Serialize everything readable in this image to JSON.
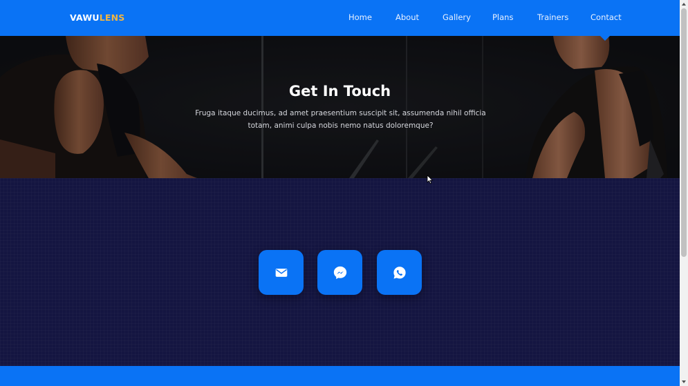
{
  "brand": {
    "logo_primary": "VAWU",
    "logo_accent": "LENS",
    "primary_color": "#0a73f5",
    "accent_color": "#f2b542"
  },
  "nav": {
    "items": [
      {
        "label": "Home"
      },
      {
        "label": "About"
      },
      {
        "label": "Gallery"
      },
      {
        "label": "Plans"
      },
      {
        "label": "Trainers"
      },
      {
        "label": "Contact"
      }
    ],
    "active": "Contact"
  },
  "hero": {
    "title": "Get In Touch",
    "text": "Fruga itaque ducimus, ad amet praesentium suscipit sit, assumenda nihil officia totam, animi culpa nobis nemo natus doloremque?"
  },
  "contact": {
    "buttons": [
      {
        "icon": "mail-icon"
      },
      {
        "icon": "messenger-icon"
      },
      {
        "icon": "whatsapp-icon"
      }
    ]
  }
}
